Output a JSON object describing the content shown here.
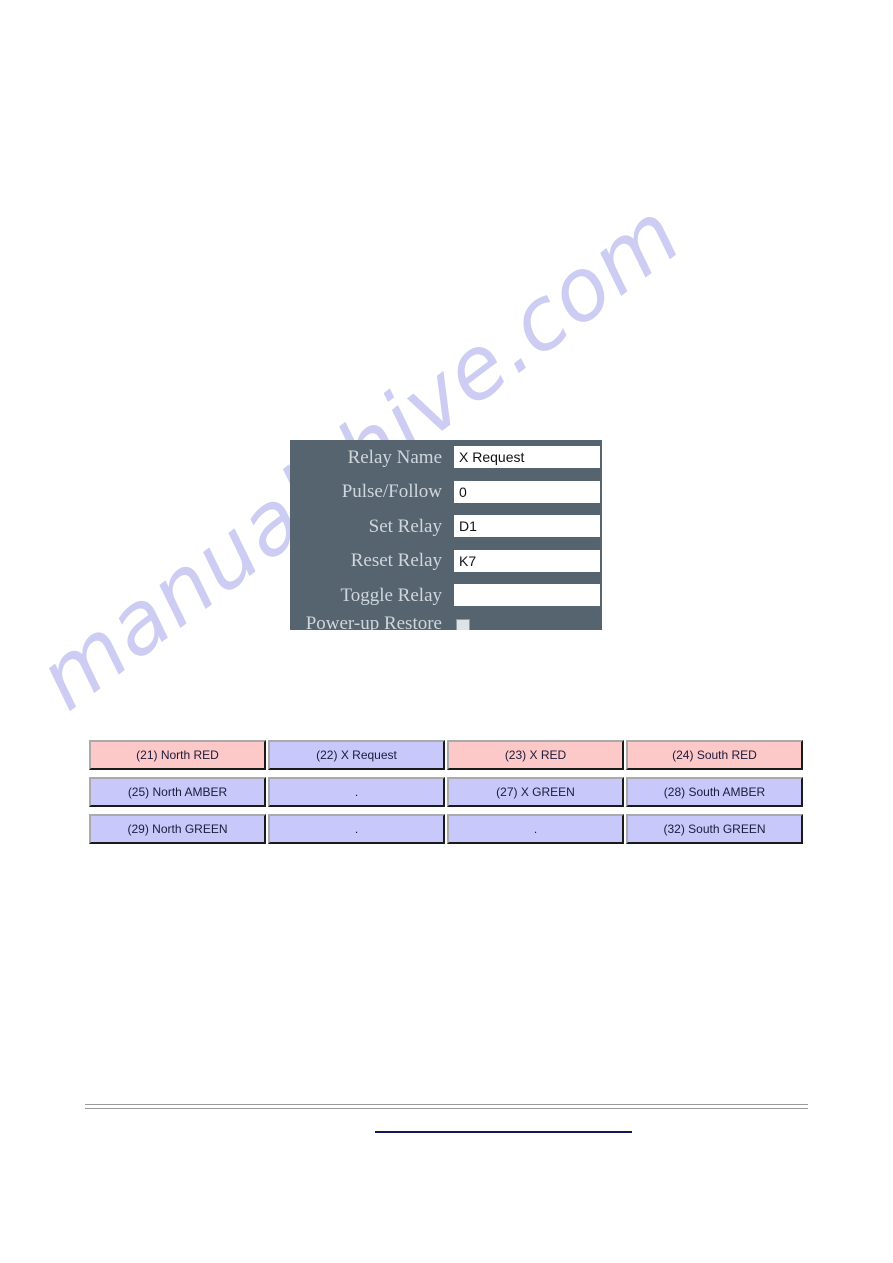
{
  "document": {
    "page_background": "#ffffff",
    "watermark": "manualshive.com"
  },
  "relay_form": {
    "panel_background": "#56646f",
    "fields": [
      {
        "label": "Relay Name",
        "value": "X Request",
        "placeholder": ""
      },
      {
        "label": "Pulse/Follow",
        "value": "0",
        "placeholder": ""
      },
      {
        "label": "Set Relay",
        "value": "D1",
        "placeholder": ""
      },
      {
        "label": "Reset Relay",
        "value": "K7",
        "placeholder": ""
      },
      {
        "label": "Toggle Relay",
        "value": "",
        "placeholder": ""
      }
    ],
    "power_up_restore": {
      "label": "Power-up Restore",
      "checked": false
    }
  },
  "relay_matrix": {
    "colors": {
      "active_red": "#fcc8c8",
      "idle_lavender": "#c8c8fa",
      "label_text": "#1b1b3a"
    },
    "rows": [
      [
        {
          "label": "(21) North RED",
          "state": "red"
        },
        {
          "label": "(22) X Request",
          "state": "idle"
        },
        {
          "label": "(23) X RED",
          "state": "red"
        },
        {
          "label": "(24) South RED",
          "state": "red"
        }
      ],
      [
        {
          "label": "(25) North AMBER",
          "state": "idle"
        },
        {
          "label": ".",
          "state": "idle"
        },
        {
          "label": "(27) X GREEN",
          "state": "idle"
        },
        {
          "label": "(28) South AMBER",
          "state": "idle"
        }
      ],
      [
        {
          "label": "(29) North GREEN",
          "state": "idle"
        },
        {
          "label": ".",
          "state": "idle"
        },
        {
          "label": ".",
          "state": "idle"
        },
        {
          "label": "(32) South GREEN",
          "state": "idle"
        }
      ]
    ]
  }
}
